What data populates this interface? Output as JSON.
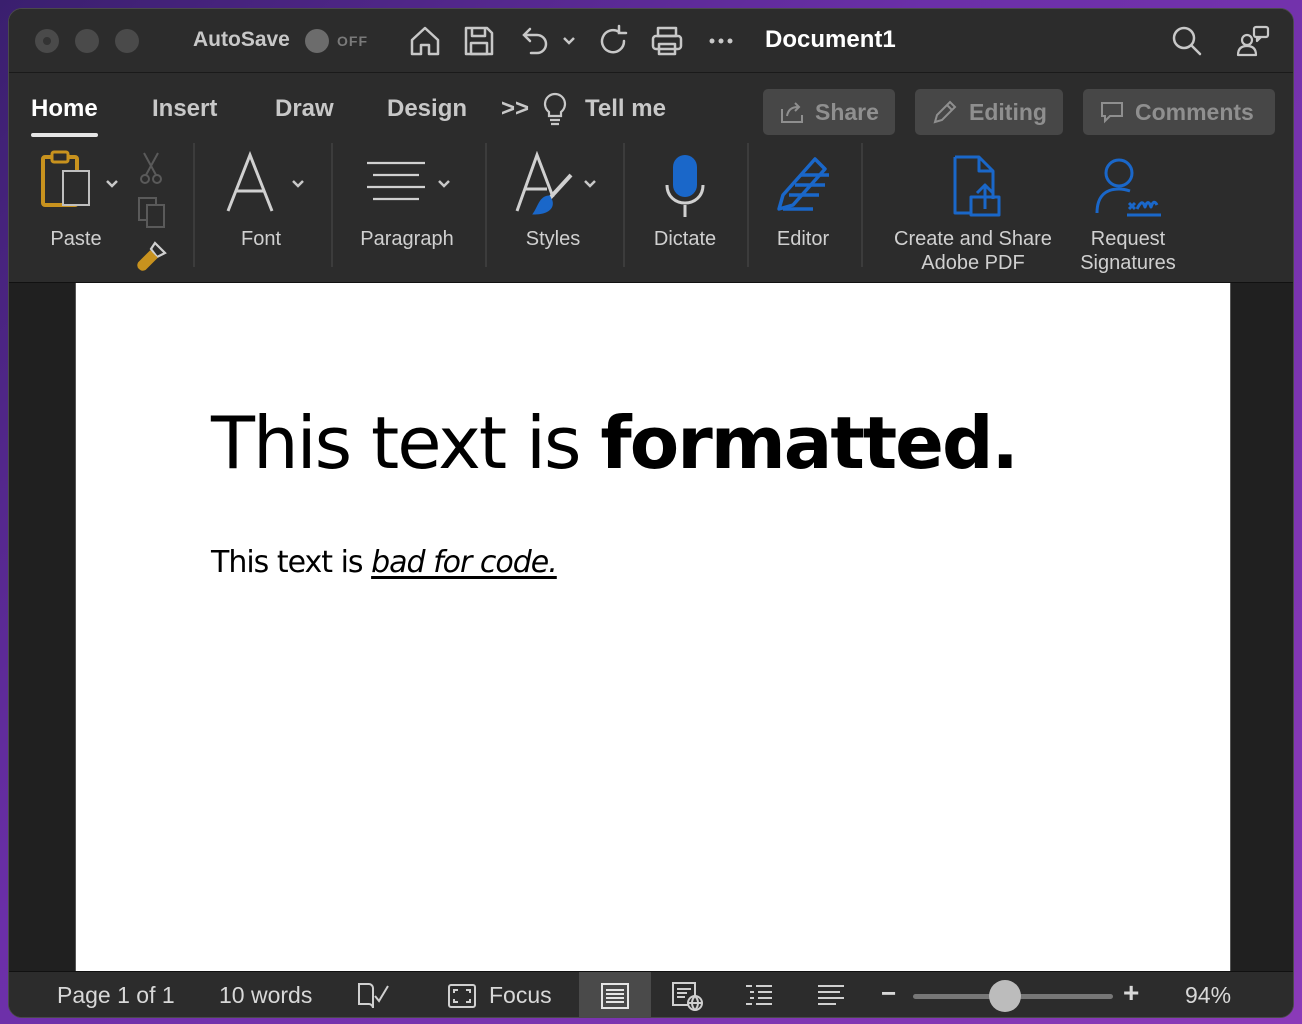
{
  "titlebar": {
    "autosave_label": "AutoSave",
    "autosave_state": "OFF",
    "document_title": "Document1"
  },
  "tabs": {
    "items": [
      {
        "label": "Home",
        "active": true
      },
      {
        "label": "Insert"
      },
      {
        "label": "Draw"
      },
      {
        "label": "Design"
      }
    ],
    "more_label": ">>",
    "tell_me": "Tell me"
  },
  "actions": {
    "share": "Share",
    "editing": "Editing",
    "comments": "Comments"
  },
  "ribbon": {
    "paste": "Paste",
    "font": "Font",
    "paragraph": "Paragraph",
    "styles": "Styles",
    "dictate": "Dictate",
    "editor": "Editor",
    "create_share_pdf_line1": "Create and Share",
    "create_share_pdf_line2": "Adobe PDF",
    "request_sig_line1": "Request",
    "request_sig_line2": "Signatures"
  },
  "document": {
    "heading_plain": "This text is ",
    "heading_bold": "formatted.",
    "body_plain": "This text is ",
    "body_formatted": "bad for code."
  },
  "statusbar": {
    "page": "Page 1 of 1",
    "words": "10 words",
    "focus": "Focus",
    "zoom": "94%",
    "zoom_minus": "−",
    "zoom_plus": "+"
  },
  "colors": {
    "accent_blue": "#1a67c9",
    "paste_gold": "#c8921e",
    "chrome_bg": "#2c2c2c"
  }
}
